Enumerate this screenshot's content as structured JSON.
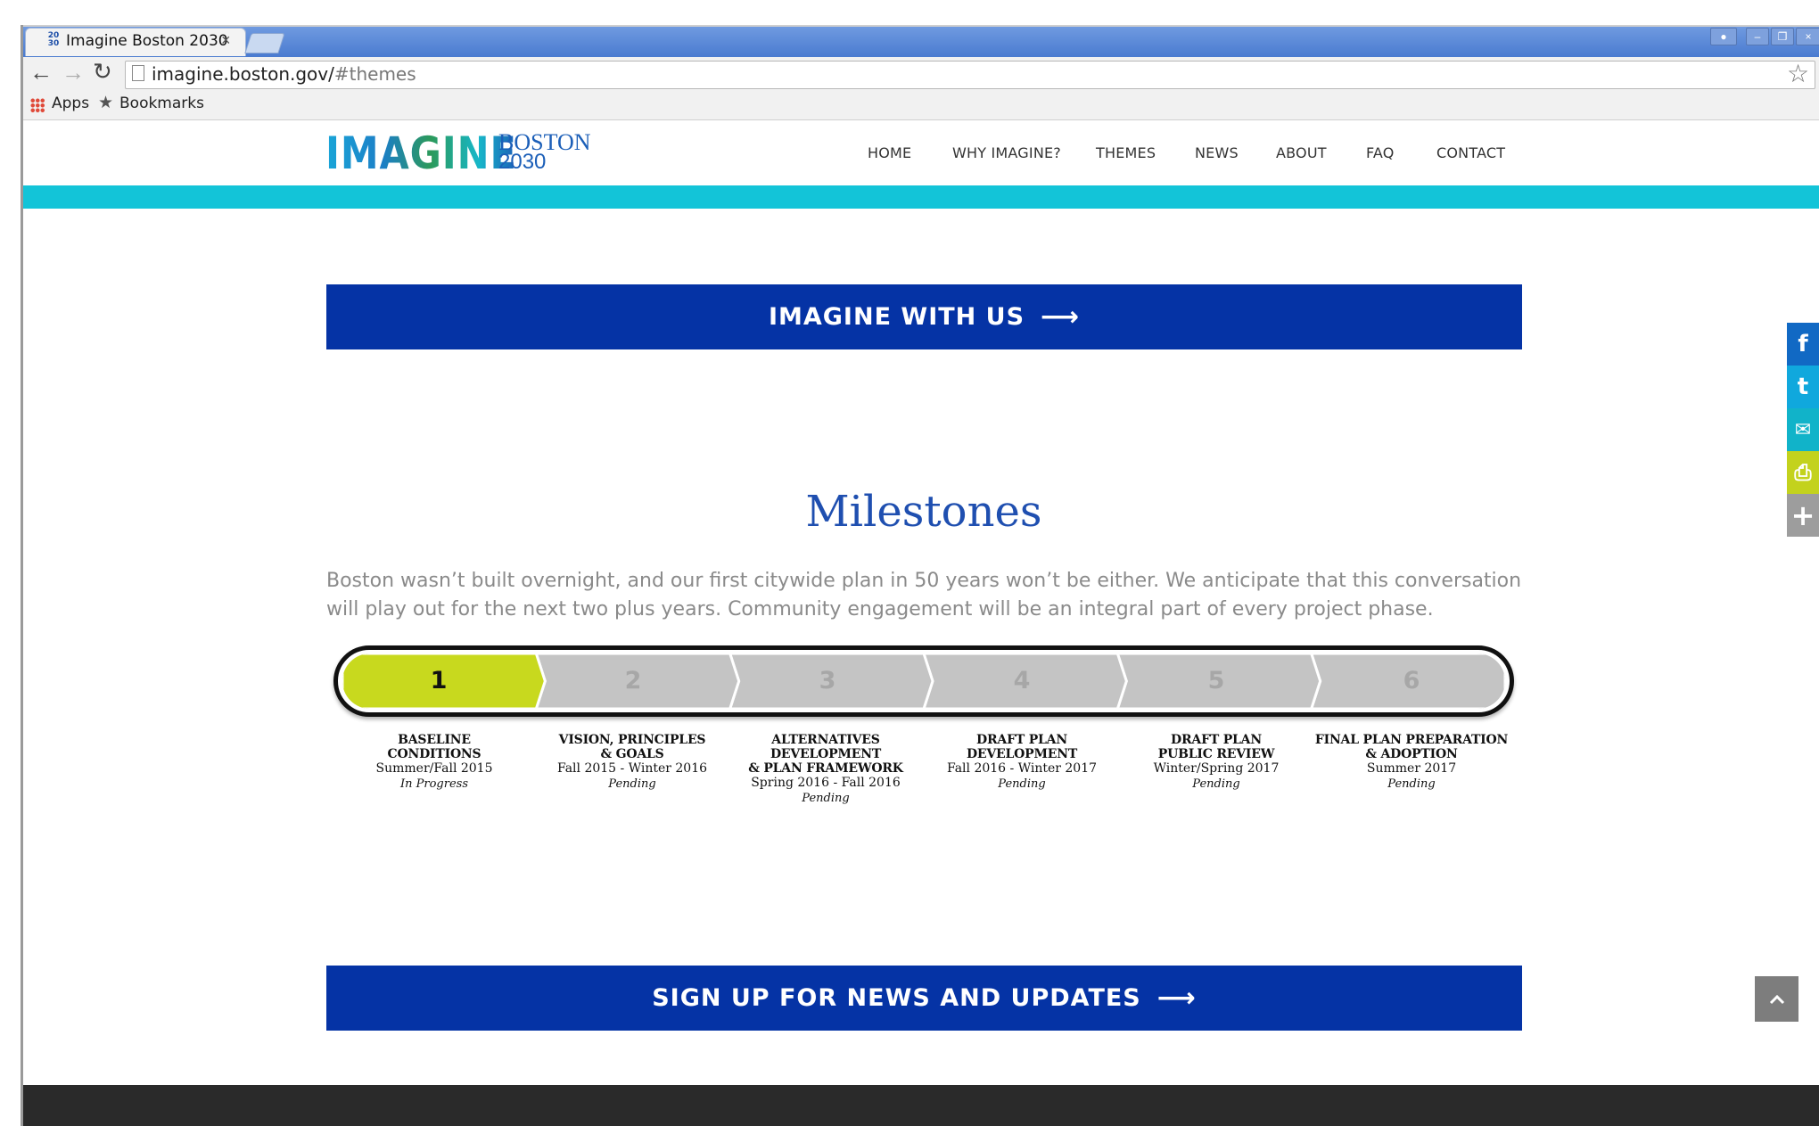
{
  "browser": {
    "tab_title": "Imagine Boston 2030",
    "tab_favicon": "20 30",
    "tab_close": "×",
    "url_host": "imagine.boston.gov/",
    "url_path": "#themes",
    "bookmarks": [
      {
        "label": "Apps",
        "icon": "apps-grid-icon"
      },
      {
        "label": "Bookmarks",
        "icon": "star-icon"
      }
    ]
  },
  "site": {
    "logo_main": "IMAGINE",
    "logo_city": "BOSTON",
    "logo_year": "2030",
    "nav": [
      "HOME",
      "WHY IMAGINE?",
      "THEMES",
      "NEWS",
      "ABOUT",
      "FAQ",
      "CONTACT"
    ],
    "accent_color": "#13c4d8",
    "brand_blue": "#0533a5"
  },
  "cta_top": {
    "label": "IMAGINE WITH US",
    "arrow": "⟶"
  },
  "milestones": {
    "title": "Milestones",
    "intro": "Boston wasn’t built overnight, and our first citywide plan in 50 years won’t be either. We anticipate that this conversation will play out for the next two plus years.  Community engagement will be an integral part of every project phase.",
    "active_stage": 1,
    "stages": [
      {
        "num": "1",
        "title_lines": [
          "BASELINE",
          "CONDITIONS"
        ],
        "dates": "Summer/Fall 2015",
        "status": "In Progress"
      },
      {
        "num": "2",
        "title_lines": [
          "VISION, PRINCIPLES",
          "& GOALS"
        ],
        "dates": "Fall 2015 - Winter 2016",
        "status": "Pending"
      },
      {
        "num": "3",
        "title_lines": [
          "ALTERNATIVES DEVELOPMENT",
          "& PLAN FRAMEWORK"
        ],
        "dates": "Spring 2016 - Fall 2016",
        "status": "Pending"
      },
      {
        "num": "4",
        "title_lines": [
          "DRAFT PLAN",
          "DEVELOPMENT"
        ],
        "dates": "Fall 2016 - Winter 2017",
        "status": "Pending"
      },
      {
        "num": "5",
        "title_lines": [
          "DRAFT PLAN",
          "PUBLIC REVIEW"
        ],
        "dates": "Winter/Spring 2017",
        "status": "Pending"
      },
      {
        "num": "6",
        "title_lines": [
          "FINAL PLAN PREPARATION",
          "& ADOPTION"
        ],
        "dates": "Summer 2017",
        "status": "Pending"
      }
    ],
    "active_color": "#c8d91e",
    "pending_color": "#c4c4c4"
  },
  "cta_bottom": {
    "label": "SIGN UP FOR NEWS AND UPDATES",
    "arrow": "⟶"
  },
  "social": [
    {
      "name": "facebook-icon",
      "glyph": "f",
      "color": "#1169c4"
    },
    {
      "name": "twitter-icon",
      "glyph": "t",
      "color": "#10a8dd"
    },
    {
      "name": "email-icon",
      "glyph": "✉",
      "color": "#11b3c9"
    },
    {
      "name": "print-icon",
      "glyph": "⎙",
      "color": "#c3d21d"
    },
    {
      "name": "more-icon",
      "glyph": "+",
      "color": "#9d9d9d"
    }
  ],
  "back_to_top_icon": "chevron-up-icon"
}
